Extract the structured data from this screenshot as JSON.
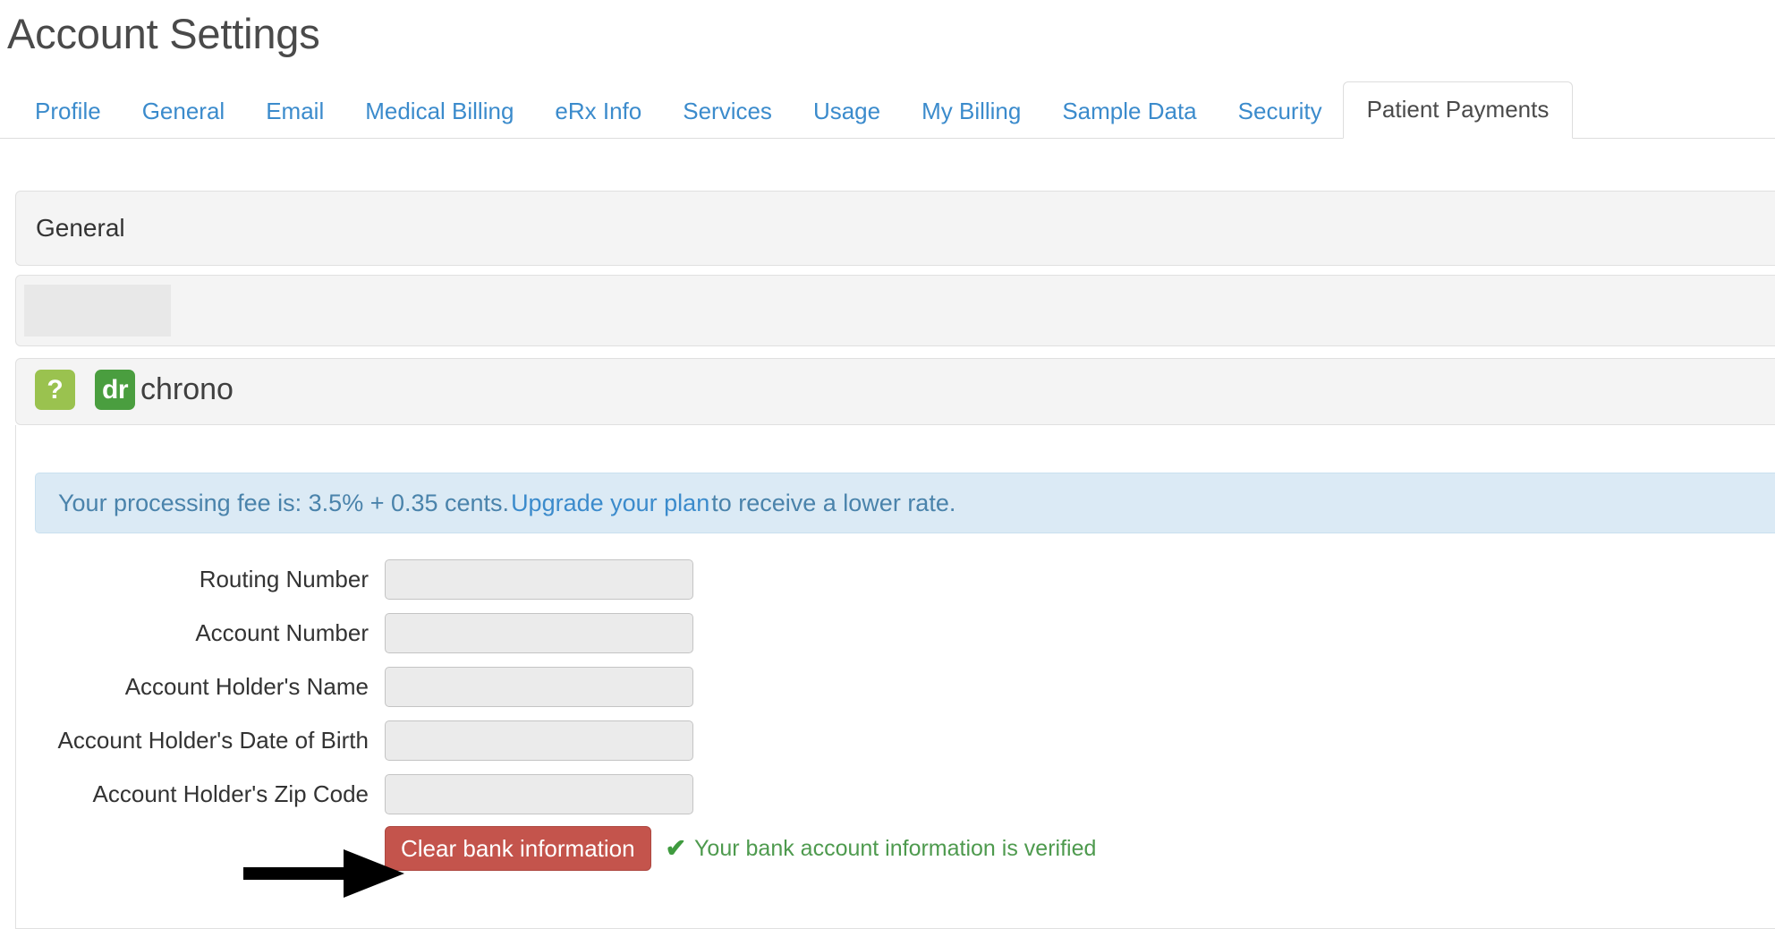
{
  "page": {
    "title": "Account Settings"
  },
  "tabs": [
    {
      "label": "Profile",
      "active": false
    },
    {
      "label": "General",
      "active": false
    },
    {
      "label": "Email",
      "active": false
    },
    {
      "label": "Medical Billing",
      "active": false
    },
    {
      "label": "eRx Info",
      "active": false
    },
    {
      "label": "Services",
      "active": false
    },
    {
      "label": "Usage",
      "active": false
    },
    {
      "label": "My Billing",
      "active": false
    },
    {
      "label": "Sample Data",
      "active": false
    },
    {
      "label": "Security",
      "active": false
    },
    {
      "label": "Patient Payments",
      "active": true
    }
  ],
  "panels": {
    "general_header": "General",
    "logo": {
      "help_badge": "?",
      "dr_badge": "dr",
      "brand_word": "chrono"
    }
  },
  "alert": {
    "text_before_link": "Your processing fee is: 3.5% + 0.35 cents. ",
    "link_text": "Upgrade your plan",
    "text_after_link": " to receive a lower rate."
  },
  "form": {
    "fields": [
      {
        "label": "Routing Number",
        "value": "",
        "placeholder": ""
      },
      {
        "label": "Account Number",
        "value": "",
        "placeholder": ""
      },
      {
        "label": "Account Holder's Name",
        "value": "",
        "placeholder": ""
      },
      {
        "label": "Account Holder's Date of Birth",
        "value": "",
        "placeholder": ""
      },
      {
        "label": "Account Holder's Zip Code",
        "value": "",
        "placeholder": ""
      }
    ],
    "clear_button_label": "Clear bank information",
    "verified_check": "✔",
    "verified_message": "Your bank account information is verified"
  },
  "colors": {
    "link_blue": "#3b8bcc",
    "alert_bg": "#dbeaf5",
    "alert_text": "#4a83ab",
    "danger_red": "#c4544c",
    "success_green": "#4e9a4e",
    "brand_green": "#4a9e3f",
    "help_green": "#9ac24f",
    "panel_bg": "#f4f4f4",
    "annotation_black": "#000000"
  },
  "annotation": {
    "arrow": "right-pointing-arrow",
    "points_to": "Clear bank information"
  }
}
